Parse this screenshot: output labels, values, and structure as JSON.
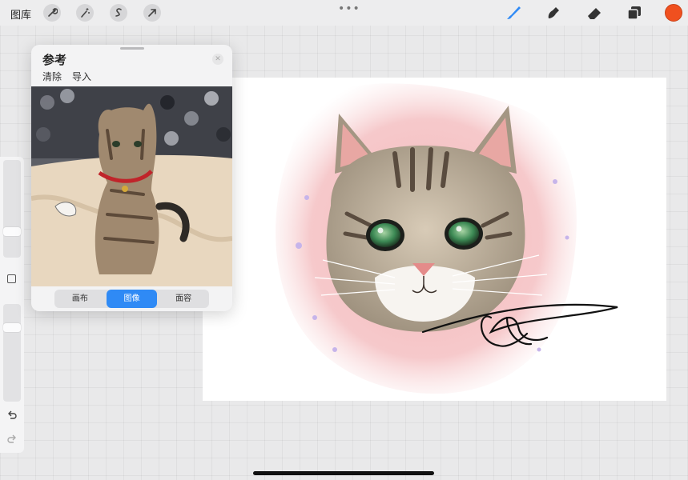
{
  "topbar": {
    "gallery_label": "图库",
    "buttons": [
      "wrench-icon",
      "magic-wand-icon",
      "selection-icon",
      "transform-arrow-icon"
    ],
    "tools": [
      "brush-icon",
      "smudge-icon",
      "eraser-icon",
      "layers-icon"
    ],
    "active_color": "#f0501f",
    "accent": "#2f8af5"
  },
  "reference": {
    "title": "参考",
    "clear_label": "清除",
    "import_label": "导入",
    "tabs": [
      "画布",
      "图像",
      "面容"
    ],
    "active_tab": "图像"
  }
}
